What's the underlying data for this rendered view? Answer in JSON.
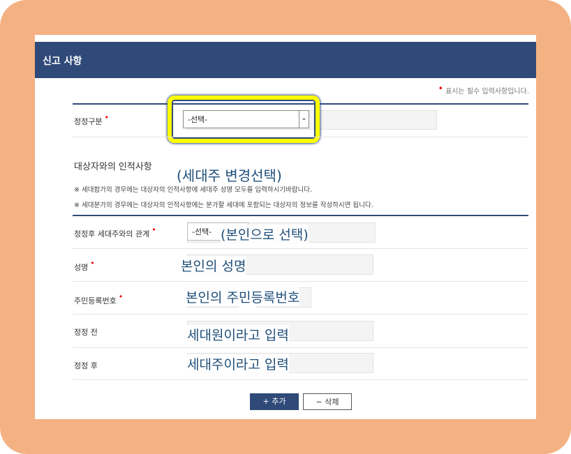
{
  "header": {
    "title": "신고 사항"
  },
  "required_note": "표시는 필수 입력사항입니다.",
  "form": {
    "correction_type": {
      "label": "정정구분",
      "select_value": "-선택-"
    },
    "section_title": "대상자와의 인적사항",
    "notes": [
      "※ 세대합가의 경우에는 대상자의 인적사항에 세대주 성명 모두를 입력하시기바랍니다.",
      "※ 세대분가의 경우에는 대상자의 인적사항에는 분가할 세대에 포함되는 대상자의 정보를 작성하시면 됩니다."
    ],
    "relation": {
      "label": "정정후 세대주와의 관계",
      "select_value": "-선택-"
    },
    "name": {
      "label": "성명"
    },
    "resident_number": {
      "label": "주민등록번호"
    },
    "before": {
      "label": "정정 전"
    },
    "after": {
      "label": "정정 후"
    }
  },
  "annotations": {
    "change_head": "(세대주 변경선택)",
    "self_select": "(본인으로 선택)",
    "self_name": "본인의 성명",
    "self_rrn": "본인의 주민등록번호",
    "enter_member": "세대원이라고 입력",
    "enter_head": "세대주이라고 입력"
  },
  "buttons": {
    "add": "+ 추가",
    "delete": "− 삭제"
  },
  "colors": {
    "header_bg": "#2f4a78",
    "frame": "#f4b183",
    "highlight": "#ffff00",
    "annotation_text": "#1f4e79"
  }
}
